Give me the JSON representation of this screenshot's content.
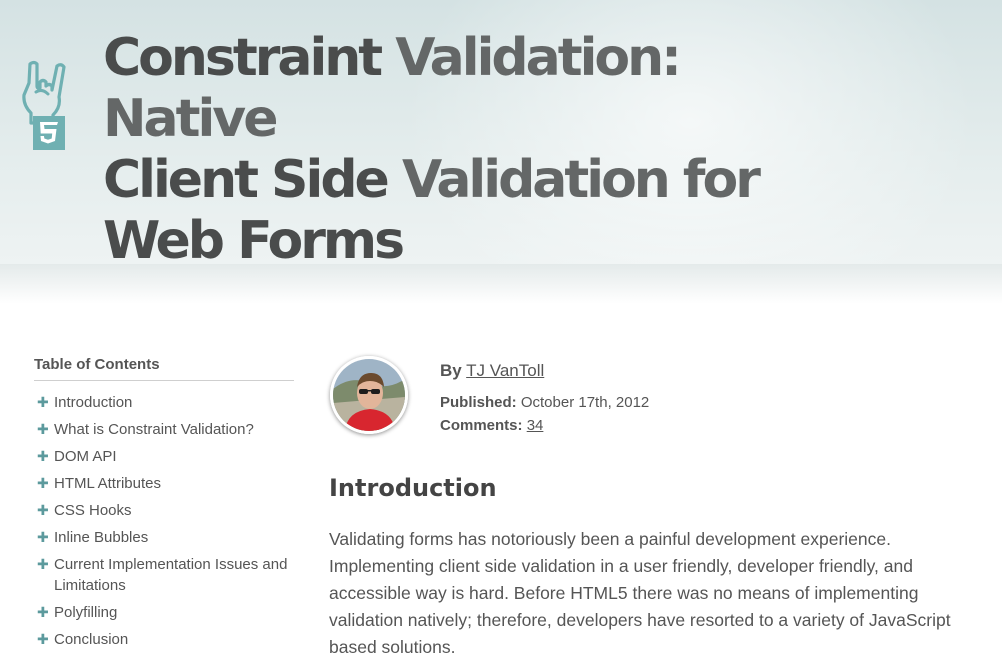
{
  "article": {
    "title_part1": "Constraint",
    "title_part2": "Validation: Native",
    "title_line2a": "Client Side",
    "title_line2b": "Validation for",
    "title_line3": "Web Forms",
    "logo_icon": "html5-rock-hand-icon"
  },
  "toc": {
    "heading": "Table of Contents",
    "items": [
      {
        "label": "Introduction"
      },
      {
        "label": "What is Constraint Validation?"
      },
      {
        "label": "DOM API"
      },
      {
        "label": "HTML Attributes"
      },
      {
        "label": "CSS Hooks"
      },
      {
        "label": "Inline Bubbles"
      },
      {
        "label": "Current Implementation Issues and Limitations"
      },
      {
        "label": "Polyfilling"
      },
      {
        "label": "Conclusion"
      }
    ]
  },
  "meta": {
    "by_label": "By",
    "author": "TJ VanToll",
    "published_label": "Published:",
    "published_date": "October 17th, 2012",
    "comments_label": "Comments:",
    "comments_count": "34"
  },
  "content": {
    "section_heading": "Introduction",
    "paragraph": "Validating forms has notoriously been a painful development experience. Implementing client side validation in a user friendly, developer friendly, and accessible way is hard. Before HTML5 there was no means of implementing validation natively; therefore, developers have resorted to a variety of JavaScript based solutions."
  },
  "colors": {
    "accent": "#5c9a9d",
    "header_bg": "#dde8e8",
    "title_dark": "#4a4c4c"
  }
}
